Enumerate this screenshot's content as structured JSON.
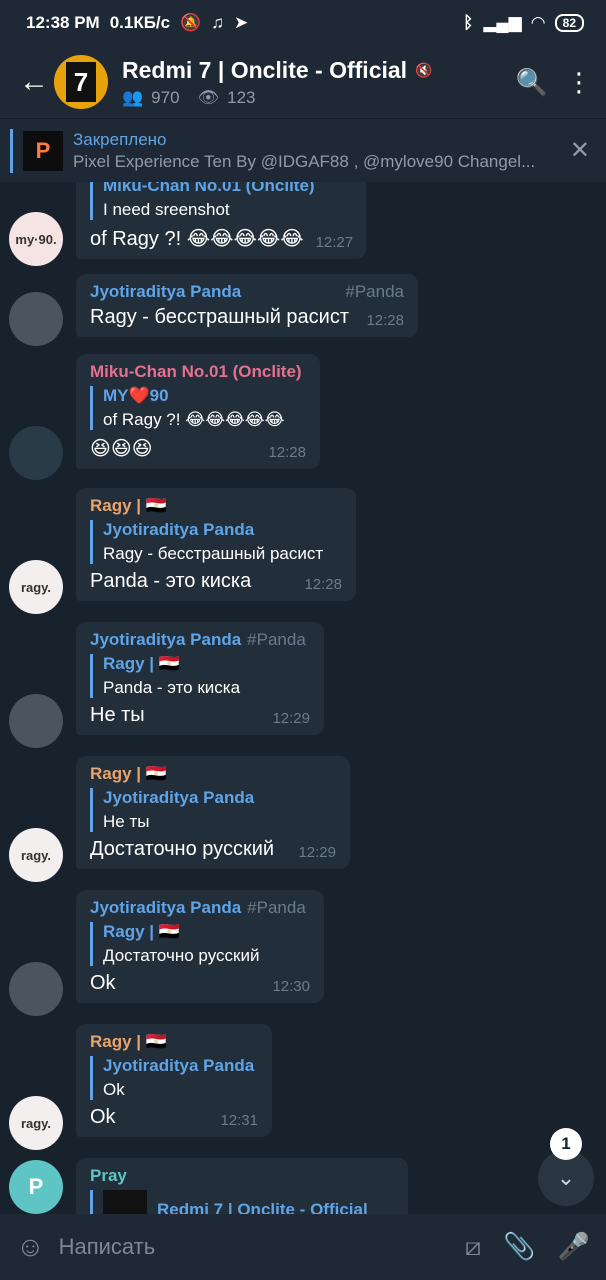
{
  "status": {
    "time": "12:38 PM",
    "speed": "0.1КБ/с",
    "battery": "82"
  },
  "header": {
    "title": "Redmi 7 | Onclite - Official",
    "members": "970",
    "online": "123",
    "avatar_text": "7"
  },
  "pinned": {
    "title": "Закреплено",
    "text": "Pixel Experience Ten By @IDGAF88 , @mylove90  Changel..."
  },
  "messages": [
    {
      "reply_name": "Miku-Chan No.01 (Onclite)",
      "reply_text": "I need sreenshot",
      "text": "of Ragy ?! 😂😂😂😂😂",
      "time": "12:27"
    },
    {
      "name": "Jyotiraditya Panda",
      "tag": "#Panda",
      "text": "Ragy - бесстрашный расист",
      "time": "12:28"
    },
    {
      "name": "Miku-Chan No.01 (Onclite)",
      "reply_name": "MY❤️90",
      "reply_text": "of Ragy ?! 😂😂😂😂😂",
      "text": "😆😆😆",
      "time": "12:28"
    },
    {
      "name": "Ragy | 🇪🇬",
      "reply_name": "Jyotiraditya Panda",
      "reply_text": "Ragy - бесстрашный расист",
      "text": "Panda - это киска",
      "time": "12:28"
    },
    {
      "name": "Jyotiraditya Panda",
      "tag": "#Panda",
      "reply_name": "Ragy | 🇪🇬",
      "reply_text": "Panda - это киска",
      "text": "Не ты",
      "time": "12:29"
    },
    {
      "name": "Ragy | 🇪🇬",
      "reply_name": "Jyotiraditya Panda",
      "reply_text": "Не ты",
      "text": "Достаточно русский",
      "time": "12:29"
    },
    {
      "name": "Jyotiraditya Panda",
      "tag": "#Panda",
      "reply_name": "Ragy | 🇪🇬",
      "reply_text": "Достаточно русский",
      "text": "Ok",
      "time": "12:30"
    },
    {
      "name": "Ragy | 🇪🇬",
      "reply_name": "Jyotiraditya Panda",
      "reply_text": "Ok",
      "text": "Ok",
      "time": "12:31"
    },
    {
      "name": "Pray",
      "reply_name": "Redmi 7 | Onclite - Official"
    }
  ],
  "avatars": {
    "mylove": "my·90.",
    "ragy": "ragy.",
    "pray": "P"
  },
  "scroll_badge": "1",
  "input": {
    "placeholder": "Написать"
  },
  "colors": {
    "jyoti": "#5fa4e6",
    "miku": "#e5708f",
    "ragy": "#e9a46b",
    "pray": "#5fc4c4"
  }
}
